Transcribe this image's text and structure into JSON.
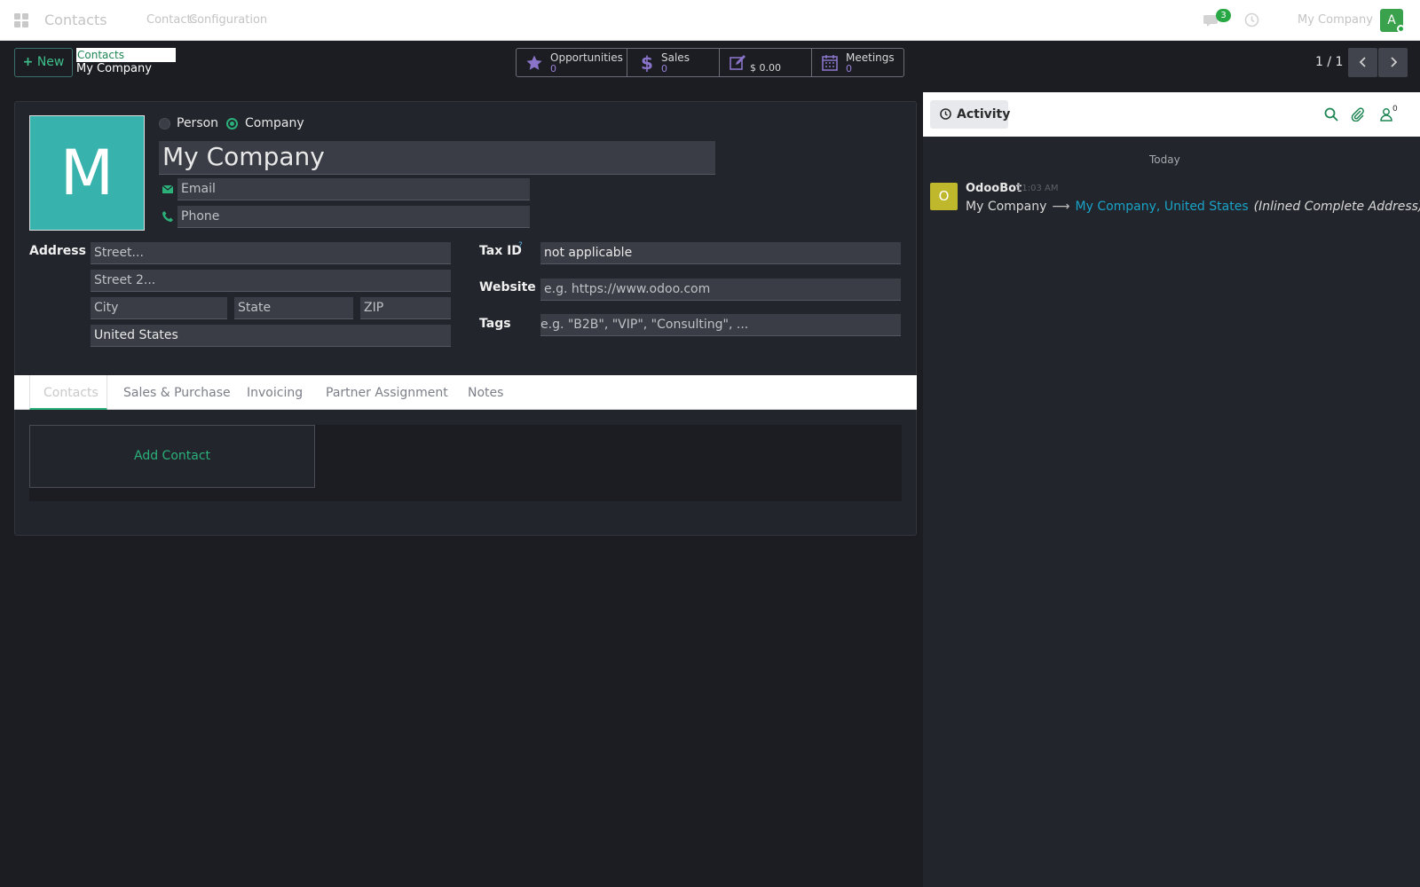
{
  "navbar": {
    "app_name": "Contacts",
    "menu": [
      "Contacts",
      "Configuration"
    ],
    "chat_badge": "3",
    "company": "My Company",
    "user_initial": "A"
  },
  "control": {
    "new_label": "New",
    "breadcrumb_parent": "Contacts",
    "breadcrumb_current": "My Company",
    "pager": "1 / 1"
  },
  "stats": [
    {
      "label": "Opportunities",
      "value": "0",
      "icon": "star-icon"
    },
    {
      "label": "Sales",
      "value": "0",
      "icon": "dollar-icon"
    },
    {
      "label": "",
      "value": "$ 0.00",
      "icon": "edit-icon"
    },
    {
      "label": "Meetings",
      "value": "0",
      "icon": "calendar-icon"
    }
  ],
  "form": {
    "avatar_letter": "M",
    "type_person": "Person",
    "type_company": "Company",
    "selected_type": "Company",
    "name": "My Company",
    "email_placeholder": "Email",
    "phone_placeholder": "Phone",
    "address_label": "Address",
    "street_placeholder": "Street...",
    "street2_placeholder": "Street 2...",
    "city_placeholder": "City",
    "state_placeholder": "State",
    "zip_placeholder": "ZIP",
    "country": "United States",
    "taxid_label": "Tax ID",
    "taxid_help": "?",
    "taxid_value": "not applicable",
    "website_label": "Website",
    "website_placeholder": "e.g. https://www.odoo.com",
    "tags_label": "Tags",
    "tags_placeholder": "e.g. \"B2B\", \"VIP\", \"Consulting\", ..."
  },
  "tabs": [
    "Contacts",
    "Sales & Purchase",
    "Invoicing",
    "Partner Assignment",
    "Notes"
  ],
  "active_tab": "Contacts",
  "add_contact_label": "Add Contact",
  "chatter": {
    "activity_label": "Activity",
    "followers_count": "0",
    "day_separator": "Today",
    "message": {
      "avatar_letter": "O",
      "author": "OdooBot",
      "time": "11:03 AM",
      "old_value": "My Company",
      "arrow": "⟶",
      "new_value": "My Company, United States",
      "field": "(Inlined Complete Address)"
    }
  },
  "colors": {
    "accent": "#2bb07a",
    "link": "#1aa3c8",
    "stat_value": "#9b7fd6",
    "avatar": "#38b2ac",
    "bot_avatar": "#c0b82c"
  }
}
